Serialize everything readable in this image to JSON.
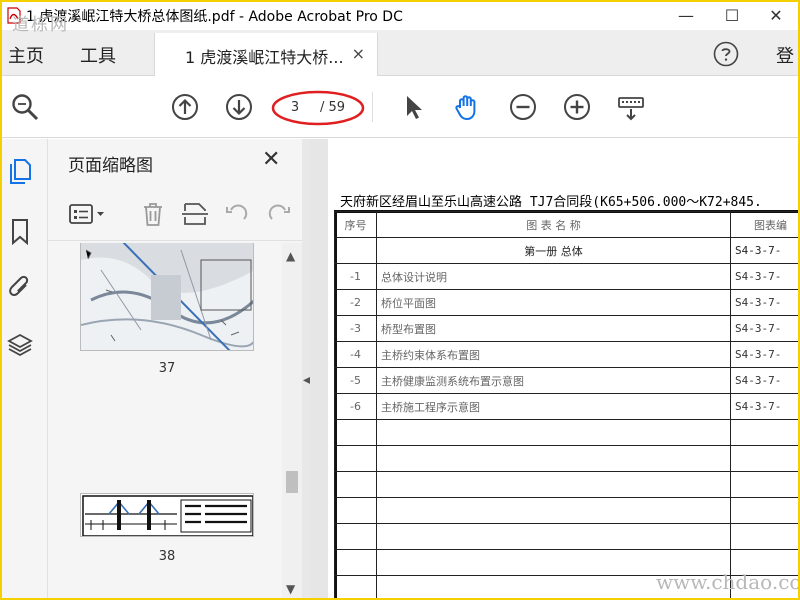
{
  "window": {
    "title": "1 虎渡溪岷江特大桥总体图纸.pdf - Adobe Acrobat Pro DC",
    "minimize": "—",
    "maximize": "☐",
    "close": "✕"
  },
  "menu": {
    "home": "主页",
    "tools": "工具",
    "sign_in": "登"
  },
  "tab": {
    "label": "1 虎渡溪岷江特大桥...",
    "close": "×"
  },
  "toolbar": {
    "current_page": "3",
    "total_pages": "/ 59",
    "annotation_color": "#e02020"
  },
  "thumbnail_panel": {
    "title": "页面缩略图",
    "close": "✕",
    "thumbnails": [
      {
        "page_label": "37"
      },
      {
        "page_label": "38"
      }
    ]
  },
  "document": {
    "header": "天府新区经眉山至乐山高速公路 TJ7合同段(K65+506.000～K72+845.",
    "columns": {
      "no": "序号",
      "name": "图 表 名 称",
      "code": "图表编"
    },
    "rows": [
      {
        "no": "",
        "name": "第一册 总体",
        "code": "S4-3-7-",
        "section": true
      },
      {
        "no": "-1",
        "name": "总体设计说明",
        "code": "S4-3-7-"
      },
      {
        "no": "-2",
        "name": "桥位平面图",
        "code": "S4-3-7-"
      },
      {
        "no": "-3",
        "name": "桥型布置图",
        "code": "S4-3-7-"
      },
      {
        "no": "-4",
        "name": "主桥约束体系布置图",
        "code": "S4-3-7-"
      },
      {
        "no": "-5",
        "name": "主桥健康监测系统布置示意图",
        "code": "S4-3-7-"
      },
      {
        "no": "-6",
        "name": "主桥施工程序示意图",
        "code": "S4-3-7-"
      },
      {
        "no": "",
        "name": "",
        "code": ""
      },
      {
        "no": "",
        "name": "",
        "code": ""
      },
      {
        "no": "",
        "name": "",
        "code": ""
      },
      {
        "no": "",
        "name": "",
        "code": ""
      },
      {
        "no": "",
        "name": "",
        "code": ""
      },
      {
        "no": "",
        "name": "",
        "code": ""
      },
      {
        "no": "",
        "name": "",
        "code": ""
      }
    ]
  },
  "watermarks": {
    "top_left": "道栋网",
    "bottom_right": "www.chdao.com"
  },
  "colors": {
    "accent": "#1473e6",
    "frame": "#f4d000"
  }
}
